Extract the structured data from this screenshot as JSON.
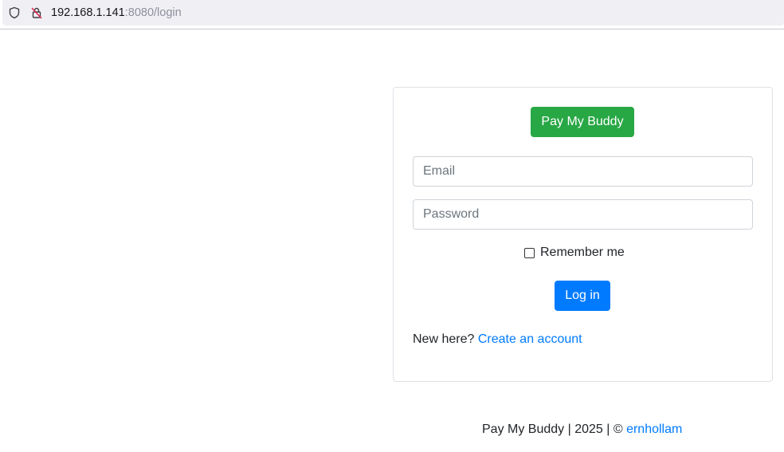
{
  "browser": {
    "url_host": "192.168.1.141",
    "url_rest": ":8080/login",
    "icons": [
      "shield-icon",
      "insecure-lock-icon"
    ]
  },
  "login": {
    "brand_label": "Pay My Buddy",
    "email_placeholder": "Email",
    "email_value": "",
    "password_placeholder": "Password",
    "password_value": "",
    "remember_label": "Remember me",
    "remember_checked": false,
    "submit_label": "Log in",
    "signup_prompt": "New here?",
    "signup_link": "Create an account"
  },
  "footer": {
    "text": "Pay My Buddy | 2025 | © ",
    "author_link": "ernhollam"
  },
  "colors": {
    "brand": "#28a745",
    "primary": "#007bff",
    "border": "#ced4da"
  }
}
